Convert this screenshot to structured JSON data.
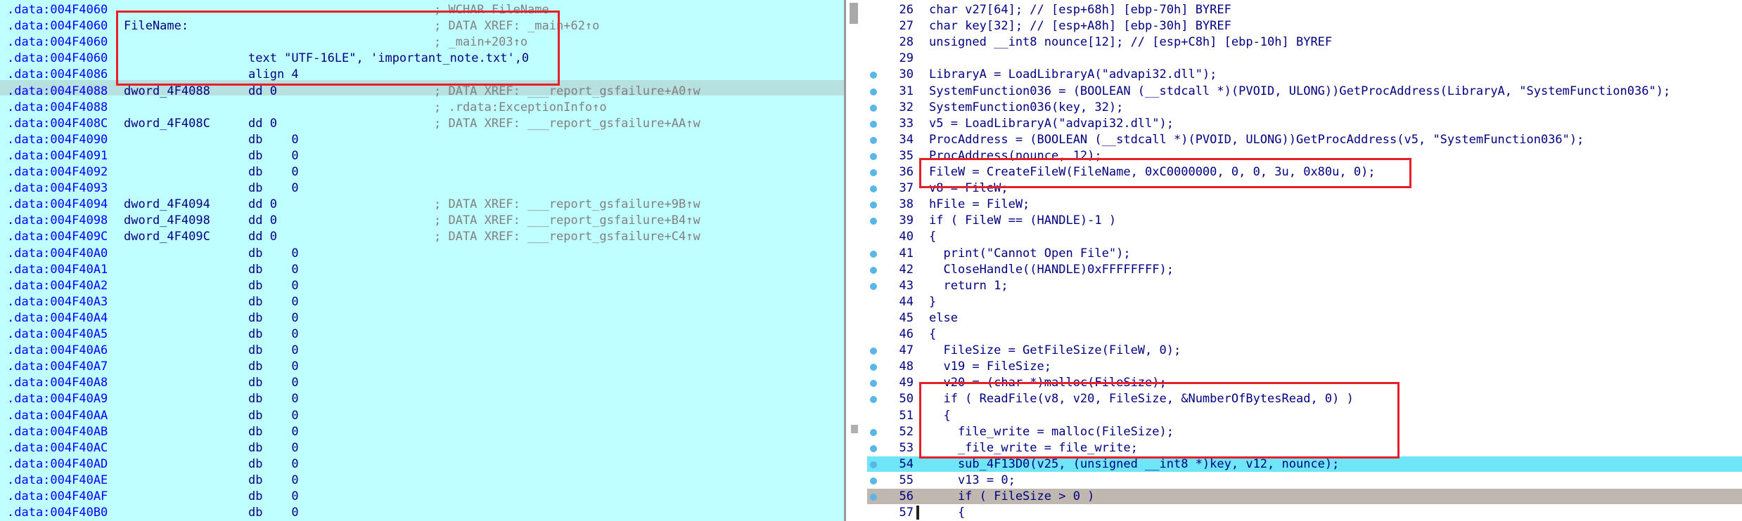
{
  "disasm_view": {
    "rows": [
      {
        "addr": ".data:004F4060",
        "label": "",
        "instr": "",
        "comment": "; WCHAR FileName"
      },
      {
        "addr": ".data:004F4060",
        "label": "FileName:",
        "instr": "",
        "comment": "; DATA XREF: _main+62↑o"
      },
      {
        "addr": ".data:004F4060",
        "label": "",
        "instr": "",
        "comment": "; _main+203↑o"
      },
      {
        "addr": ".data:004F4060",
        "label": "",
        "instr": "text \"UTF-16LE\", 'important_note.txt',0",
        "comment": ""
      },
      {
        "addr": ".data:004F4086",
        "label": "",
        "instr": "align 4",
        "comment": ""
      },
      {
        "addr": ".data:004F4088",
        "label": "dword_4F4088",
        "instr": "dd 0",
        "comment": "; DATA XREF: ___report_gsfailure+A0↑w"
      },
      {
        "addr": ".data:004F4088",
        "label": "",
        "instr": "",
        "comment": "; .rdata:ExceptionInfo↑o"
      },
      {
        "addr": ".data:004F408C",
        "label": "dword_4F408C",
        "instr": "dd 0",
        "comment": "; DATA XREF: ___report_gsfailure+AA↑w"
      },
      {
        "addr": ".data:004F4090",
        "label": "",
        "instr": "db    0",
        "comment": ""
      },
      {
        "addr": ".data:004F4091",
        "label": "",
        "instr": "db    0",
        "comment": ""
      },
      {
        "addr": ".data:004F4092",
        "label": "",
        "instr": "db    0",
        "comment": ""
      },
      {
        "addr": ".data:004F4093",
        "label": "",
        "instr": "db    0",
        "comment": ""
      },
      {
        "addr": ".data:004F4094",
        "label": "dword_4F4094",
        "instr": "dd 0",
        "comment": "; DATA XREF: ___report_gsfailure+9B↑w"
      },
      {
        "addr": ".data:004F4098",
        "label": "dword_4F4098",
        "instr": "dd 0",
        "comment": "; DATA XREF: ___report_gsfailure+B4↑w"
      },
      {
        "addr": ".data:004F409C",
        "label": "dword_4F409C",
        "instr": "dd 0",
        "comment": "; DATA XREF: ___report_gsfailure+C4↑w"
      },
      {
        "addr": ".data:004F40A0",
        "label": "",
        "instr": "db    0",
        "comment": ""
      },
      {
        "addr": ".data:004F40A1",
        "label": "",
        "instr": "db    0",
        "comment": ""
      },
      {
        "addr": ".data:004F40A2",
        "label": "",
        "instr": "db    0",
        "comment": ""
      },
      {
        "addr": ".data:004F40A3",
        "label": "",
        "instr": "db    0",
        "comment": ""
      },
      {
        "addr": ".data:004F40A4",
        "label": "",
        "instr": "db    0",
        "comment": ""
      },
      {
        "addr": ".data:004F40A5",
        "label": "",
        "instr": "db    0",
        "comment": ""
      },
      {
        "addr": ".data:004F40A6",
        "label": "",
        "instr": "db    0",
        "comment": ""
      },
      {
        "addr": ".data:004F40A7",
        "label": "",
        "instr": "db    0",
        "comment": ""
      },
      {
        "addr": ".data:004F40A8",
        "label": "",
        "instr": "db    0",
        "comment": ""
      },
      {
        "addr": ".data:004F40A9",
        "label": "",
        "instr": "db    0",
        "comment": ""
      },
      {
        "addr": ".data:004F40AA",
        "label": "",
        "instr": "db    0",
        "comment": ""
      },
      {
        "addr": ".data:004F40AB",
        "label": "",
        "instr": "db    0",
        "comment": ""
      },
      {
        "addr": ".data:004F40AC",
        "label": "",
        "instr": "db    0",
        "comment": ""
      },
      {
        "addr": ".data:004F40AD",
        "label": "",
        "instr": "db    0",
        "comment": ""
      },
      {
        "addr": ".data:004F40AE",
        "label": "",
        "instr": "db    0",
        "comment": ""
      },
      {
        "addr": ".data:004F40AF",
        "label": "",
        "instr": "db    0",
        "comment": ""
      },
      {
        "addr": ".data:004F40B0",
        "label": "",
        "instr": "db    0",
        "comment": ""
      }
    ]
  },
  "pseudocode_view": {
    "lines": [
      {
        "num": "26",
        "text": "char v27[64]; // [esp+68h] [ebp-70h] BYREF",
        "dot": false
      },
      {
        "num": "27",
        "text": "char key[32]; // [esp+A8h] [ebp-30h] BYREF",
        "dot": false
      },
      {
        "num": "28",
        "text": "unsigned __int8 nounce[12]; // [esp+C8h] [ebp-10h] BYREF",
        "dot": false
      },
      {
        "num": "29",
        "text": "",
        "dot": false
      },
      {
        "num": "30",
        "text": "LibraryA = LoadLibraryA(\"advapi32.dll\");",
        "dot": true
      },
      {
        "num": "31",
        "text": "SystemFunction036 = (BOOLEAN (__stdcall *)(PVOID, ULONG))GetProcAddress(LibraryA, \"SystemFunction036\");",
        "dot": true
      },
      {
        "num": "32",
        "text": "SystemFunction036(key, 32);",
        "dot": true
      },
      {
        "num": "33",
        "text": "v5 = LoadLibraryA(\"advapi32.dll\");",
        "dot": true
      },
      {
        "num": "34",
        "text": "ProcAddress = (BOOLEAN (__stdcall *)(PVOID, ULONG))GetProcAddress(v5, \"SystemFunction036\");",
        "dot": true
      },
      {
        "num": "35",
        "text": "ProcAddress(nounce, 12);",
        "dot": true
      },
      {
        "num": "36",
        "text": "FileW = CreateFileW(FileName, 0xC0000000, 0, 0, 3u, 0x80u, 0);",
        "dot": true
      },
      {
        "num": "37",
        "text": "v8 = FileW;",
        "dot": true
      },
      {
        "num": "38",
        "text": "hFile = FileW;",
        "dot": true
      },
      {
        "num": "39",
        "text": "if ( FileW == (HANDLE)-1 )",
        "dot": true
      },
      {
        "num": "40",
        "text": "{",
        "dot": false
      },
      {
        "num": "41",
        "text": "  print(\"Cannot Open File\");",
        "dot": true
      },
      {
        "num": "42",
        "text": "  CloseHandle((HANDLE)0xFFFFFFFF);",
        "dot": true
      },
      {
        "num": "43",
        "text": "  return 1;",
        "dot": true
      },
      {
        "num": "44",
        "text": "}",
        "dot": false
      },
      {
        "num": "45",
        "text": "else",
        "dot": false
      },
      {
        "num": "46",
        "text": "{",
        "dot": false
      },
      {
        "num": "47",
        "text": "  FileSize = GetFileSize(FileW, 0);",
        "dot": true
      },
      {
        "num": "48",
        "text": "  v19 = FileSize;",
        "dot": true
      },
      {
        "num": "49",
        "text": "  v20 = (char *)malloc(FileSize);",
        "dot": true
      },
      {
        "num": "50",
        "text": "  if ( ReadFile(v8, v20, FileSize, &NumberOfBytesRead, 0) )",
        "dot": true
      },
      {
        "num": "51",
        "text": "  {",
        "dot": false
      },
      {
        "num": "52",
        "text": "    file_write = malloc(FileSize);",
        "dot": true
      },
      {
        "num": "53",
        "text": "    _file_write = file_write;",
        "dot": true
      },
      {
        "num": "54",
        "text": "    sub_4F13D0(v25, (unsigned __int8 *)key, v12, nounce);",
        "dot": true
      },
      {
        "num": "55",
        "text": "    v13 = 0;",
        "dot": true
      },
      {
        "num": "56",
        "text": "    if ( FileSize > 0 )",
        "dot": true
      },
      {
        "num": "57",
        "text": "    {",
        "dot": false
      }
    ]
  },
  "colors": {
    "disasm_background": "#c0ffff",
    "pseudocode_background": "#ffffff",
    "current_line_highlight": "#6fe6f7",
    "selected_line_highlight": "#c0b8b0",
    "annotation_box": "#e5202a",
    "breakpoint_dot": "#59b6e6"
  }
}
